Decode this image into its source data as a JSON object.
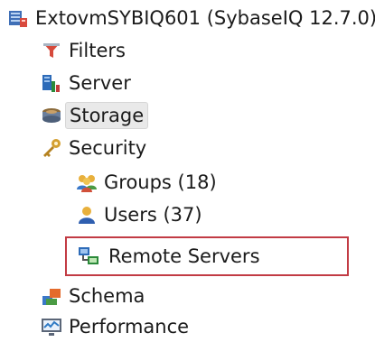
{
  "tree": {
    "root": {
      "label": "ExtovmSYBIQ601 (SybaseIQ 12.7.0)",
      "icon": "database-server-icon"
    },
    "items": [
      {
        "label": "Filters",
        "icon": "funnel-filter-icon"
      },
      {
        "label": "Server",
        "icon": "server-icon"
      },
      {
        "label": "Storage",
        "icon": "storage-disk-icon",
        "selected": true
      },
      {
        "label": "Security",
        "icon": "key-icon"
      },
      {
        "label": "Groups (18)",
        "icon": "user-group-icon"
      },
      {
        "label": "Users (37)",
        "icon": "user-icon"
      },
      {
        "label": "Remote Servers",
        "icon": "remote-servers-icon",
        "highlighted": true
      },
      {
        "label": "Schema",
        "icon": "schema-icon"
      },
      {
        "label": "Performance",
        "icon": "performance-monitor-icon"
      }
    ]
  },
  "colors": {
    "highlight_border": "#c23b44",
    "selected_background": "#e9e9e9"
  }
}
